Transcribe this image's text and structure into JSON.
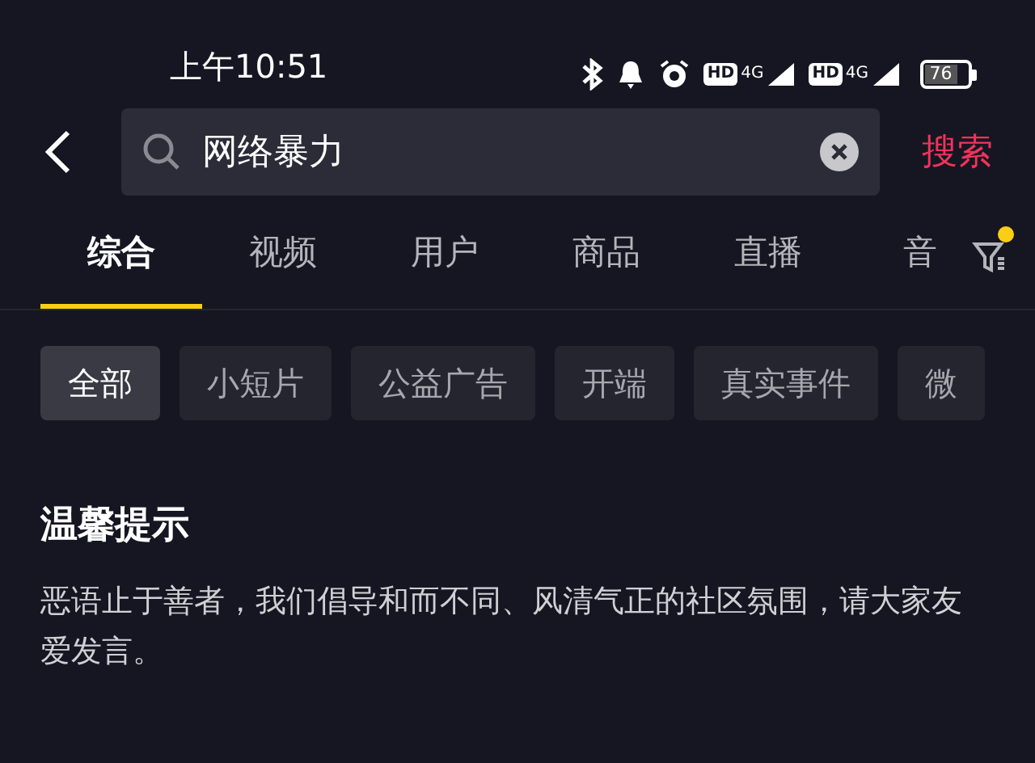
{
  "status_bar": {
    "time": "上午10:51",
    "sims": [
      {
        "hd": "HD",
        "network": "4G"
      },
      {
        "hd": "HD",
        "network": "4G"
      }
    ],
    "battery": "76"
  },
  "search": {
    "value": "网络暴力",
    "button": "搜索"
  },
  "tabs": [
    {
      "label": "综合",
      "selected": true
    },
    {
      "label": "视频",
      "selected": false
    },
    {
      "label": "用户",
      "selected": false
    },
    {
      "label": "商品",
      "selected": false
    },
    {
      "label": "直播",
      "selected": false
    },
    {
      "label": "音",
      "selected": false
    }
  ],
  "filter": {
    "has_dot": true
  },
  "chips": [
    {
      "label": "全部",
      "selected": true
    },
    {
      "label": "小短片",
      "selected": false
    },
    {
      "label": "公益广告",
      "selected": false
    },
    {
      "label": "开端",
      "selected": false
    },
    {
      "label": "真实事件",
      "selected": false
    },
    {
      "label": "微",
      "selected": false
    }
  ],
  "notice": {
    "title": "温馨提示",
    "text": "恶语止于善者，我们倡导和而不同、风清气正的社区氛围，请大家友爱发言。"
  }
}
